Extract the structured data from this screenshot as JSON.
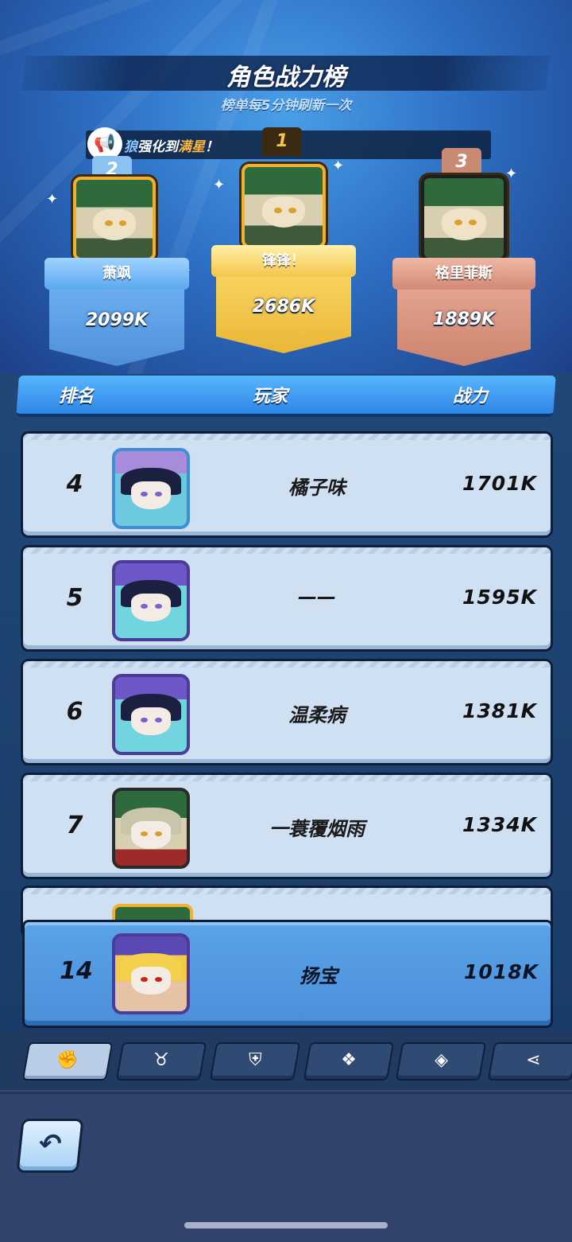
{
  "header": {
    "title": "角色战力榜",
    "subtitle": "榜单每5分钟刷新一次"
  },
  "announcement": {
    "prefix": "狼",
    "text": "强化到",
    "highlight": "满星",
    "suffix": "！",
    "icon": "megaphone-icon"
  },
  "podium": {
    "second": {
      "rank": "2",
      "name": "萧飒",
      "power": "2099K"
    },
    "first": {
      "rank": "1",
      "name": "锋锋！",
      "power": "2686K"
    },
    "third": {
      "rank": "3",
      "name": "格里菲斯",
      "power": "1889K"
    }
  },
  "table": {
    "columns": [
      "排名",
      "玩家",
      "战力"
    ],
    "rows": [
      {
        "rank": "4",
        "name": "橘子味",
        "power": "1701K"
      },
      {
        "rank": "5",
        "name": "——",
        "power": "1595K"
      },
      {
        "rank": "6",
        "name": "温柔病",
        "power": "1381K"
      },
      {
        "rank": "7",
        "name": "一蓑覆烟雨",
        "power": "1334K"
      }
    ]
  },
  "self": {
    "rank": "14",
    "name": "扬宝",
    "power": "1018K"
  },
  "tabs": [
    {
      "icon": "fist-icon",
      "glyph": "✊"
    },
    {
      "icon": "bull-horns-icon",
      "glyph": "♉"
    },
    {
      "icon": "shield-badge-icon",
      "glyph": "⛨"
    },
    {
      "icon": "cards-icon",
      "glyph": "❖"
    },
    {
      "icon": "card-icon",
      "glyph": "◈"
    },
    {
      "icon": "share-icon",
      "glyph": "⋖"
    }
  ],
  "back": {
    "icon": "back-arrow-icon",
    "glyph": "↶"
  },
  "colors": {
    "accent_blue": "#2f86e6",
    "gold": "#f3b02d",
    "silver_blue": "#8cc2f2",
    "bronze": "#d18a76",
    "row_bg": "#cfe0f2",
    "self_row_bg": "#5aa3e8"
  }
}
